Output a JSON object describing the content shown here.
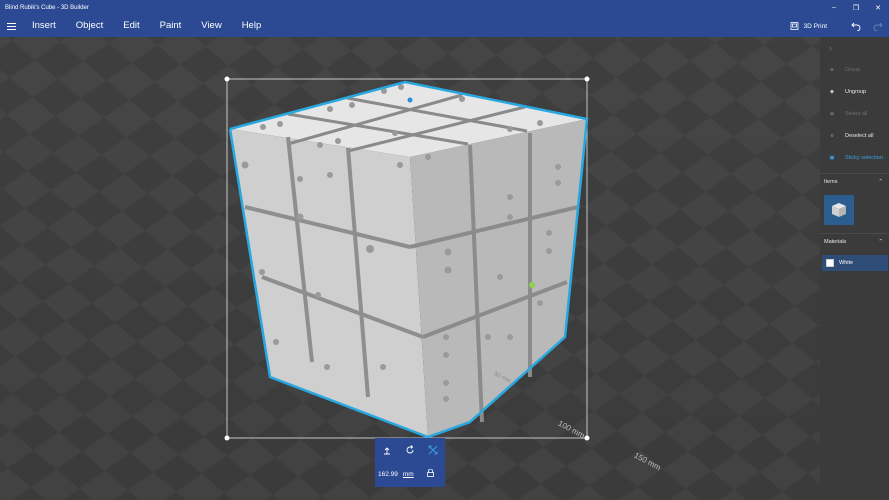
{
  "window": {
    "title": "Blind Rubik's Cube - 3D Builder"
  },
  "menu": {
    "items": [
      "Insert",
      "Object",
      "Edit",
      "Paint",
      "View",
      "Help"
    ],
    "print_label": "3D Print"
  },
  "viewport": {
    "dimension_labels": [
      "100 mm",
      "150 mm",
      "50 mm"
    ]
  },
  "toolbar": {
    "size_value": "162.99",
    "unit": "mm"
  },
  "panel": {
    "actions": [
      {
        "label": "Group",
        "state": "disabled"
      },
      {
        "label": "Ungroup",
        "state": "enabled"
      },
      {
        "label": "Select all",
        "state": "disabled"
      },
      {
        "label": "Deselect all",
        "state": "enabled"
      },
      {
        "label": "Sticky selection",
        "state": "active"
      }
    ],
    "items_heading": "Items",
    "materials_heading": "Materials",
    "material_name": "White"
  },
  "colors": {
    "accent": "#2b4a93",
    "selection": "#29a8e0",
    "panel": "#3b3b3b"
  }
}
